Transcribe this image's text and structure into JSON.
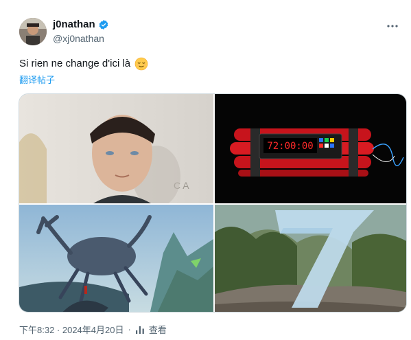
{
  "author": {
    "display_name": "j0nathan",
    "handle": "@xj0nathan"
  },
  "tweet": {
    "text": "Si rien ne change d'ici là",
    "emoji": "relieved-face",
    "translate_label": "翻译帖子"
  },
  "media": {
    "images": [
      {
        "name": "portrait-photo"
      },
      {
        "name": "timer-bomb",
        "timer_text": "72:00:00"
      },
      {
        "name": "giant-crab-artwork"
      },
      {
        "name": "number-seven-landscape"
      }
    ]
  },
  "footer": {
    "timestamp": "下午8:32 · 2024年4月20日",
    "separator": "·",
    "views_label": "查看"
  },
  "colors": {
    "link": "#1d9bf0",
    "secondary_text": "#536471",
    "verified": "#1d9bf0"
  }
}
